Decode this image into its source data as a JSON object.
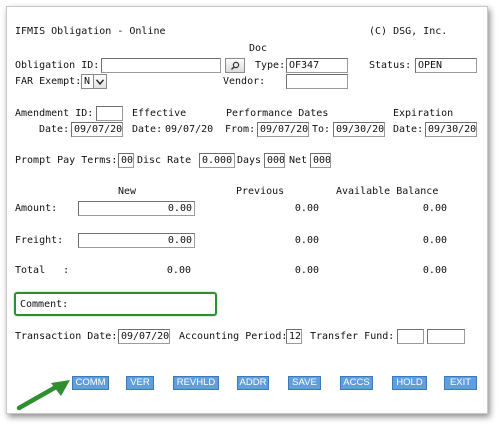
{
  "header": {
    "title": "IFMIS Obligation - Online",
    "copyright": "(C) DSG, Inc."
  },
  "obligation": {
    "id_label": "Obligation ID:",
    "id_value": "",
    "doc_label": "Doc",
    "type_label": "Type:",
    "type_value": "OF347",
    "status_label": "Status:",
    "status_value": "OPEN",
    "far_label": "FAR Exempt:",
    "far_value": "N",
    "vendor_label": "Vendor:",
    "vendor_value": ""
  },
  "dates": {
    "amendment_label": "Amendment ID:",
    "amendment_value": "",
    "effective_label": "Effective",
    "performance_label": "Performance Dates",
    "expiration_label": "Expiration",
    "date_label": "Date:",
    "date_value": "09/07/20",
    "eff_date_label": "Date:",
    "eff_date_value": "09/07/20",
    "from_label": "From:",
    "from_value": "09/07/20",
    "to_label": "To:",
    "to_value": "09/30/20",
    "exp_date_label": "Date:",
    "exp_date_value": "09/30/20"
  },
  "prompt_pay": {
    "terms_label": "Prompt Pay Terms:",
    "terms_value": "00",
    "disc_label": "Disc Rate",
    "disc_value": "0.000",
    "days_label": "Days",
    "days_value": "000",
    "net_label": "Net",
    "net_value": "000"
  },
  "amounts": {
    "headers": {
      "new": "New",
      "previous": "Previous",
      "available": "Available Balance"
    },
    "amount": {
      "label": "Amount:",
      "new": "0.00",
      "previous": "0.00",
      "available": "0.00"
    },
    "freight": {
      "label": "Freight:",
      "new": "0.00",
      "previous": "0.00",
      "available": "0.00"
    },
    "total": {
      "label": "Total   :",
      "new": "0.00",
      "previous": "0.00",
      "available": "0.00"
    }
  },
  "comment": {
    "label": "Comment:"
  },
  "transaction": {
    "date_label": "Transaction Date:",
    "date_value": "09/07/20",
    "period_label": "Accounting Period:",
    "period_value": "12",
    "fund_label": "Transfer Fund:",
    "fund_value_1": "",
    "fund_value_2": ""
  },
  "buttons": {
    "comm": "COMM",
    "ver": "VER",
    "revhld": "REVHLD",
    "addr": "ADDR",
    "save": "SAVE",
    "accs": "ACCS",
    "hold": "HOLD",
    "exit": "EXIT"
  },
  "colors": {
    "button": "#5f9fde",
    "highlight": "#2f8f2f",
    "arrow": "#2f8f2f"
  },
  "icons": {
    "search": "search-icon",
    "dropdown": "chevron-down-icon",
    "pointer": "arrow-icon"
  }
}
